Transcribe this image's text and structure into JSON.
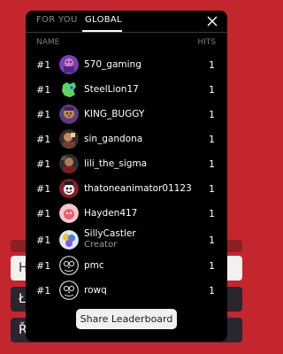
{
  "background": {
    "buttons": [
      {
        "letter": "H"
      },
      {
        "letter": "Ł"
      },
      {
        "letter": "Ř"
      }
    ]
  },
  "tabs": [
    {
      "label": "FOR YOU",
      "active": false
    },
    {
      "label": "GLOBAL",
      "active": true
    }
  ],
  "columns": {
    "name": "NAME",
    "hits": "HITS"
  },
  "entries": [
    {
      "rank": "#1",
      "name": "570_gaming",
      "hits": "1",
      "avatar": "purple-meme-avatar"
    },
    {
      "rank": "#1",
      "name": "SteelLion17",
      "hits": "1",
      "avatar": "green-lion-avatar"
    },
    {
      "rank": "#1",
      "name": "KING_BUGGY",
      "hits": "1",
      "avatar": "buggy-avatar"
    },
    {
      "rank": "#1",
      "name": "sin_gandona",
      "hits": "1",
      "avatar": "photo-avatar"
    },
    {
      "rank": "#1",
      "name": "lili_the_sigma",
      "hits": "1",
      "avatar": "photo-avatar"
    },
    {
      "rank": "#1",
      "name": "thatoneanimator01123",
      "hits": "1",
      "avatar": "cartoon-face-avatar"
    },
    {
      "rank": "#1",
      "name": "Hayden417",
      "hits": "1",
      "avatar": "pink-avatar"
    },
    {
      "rank": "#1",
      "name": "SillyCastler",
      "subtitle": "Creator",
      "hits": "1",
      "avatar": "colorful-avatar"
    },
    {
      "rank": "#1",
      "name": "pmc",
      "hits": "1",
      "avatar": "owl-emblem-avatar"
    },
    {
      "rank": "#1",
      "name": "rowq",
      "hits": "1",
      "avatar": "owl-emblem-avatar"
    }
  ],
  "share_button": "Share Leaderboard",
  "colors": {
    "page_bg": "#c4262e",
    "panel_bg": "#000000",
    "button_bg": "#f2eff3"
  }
}
